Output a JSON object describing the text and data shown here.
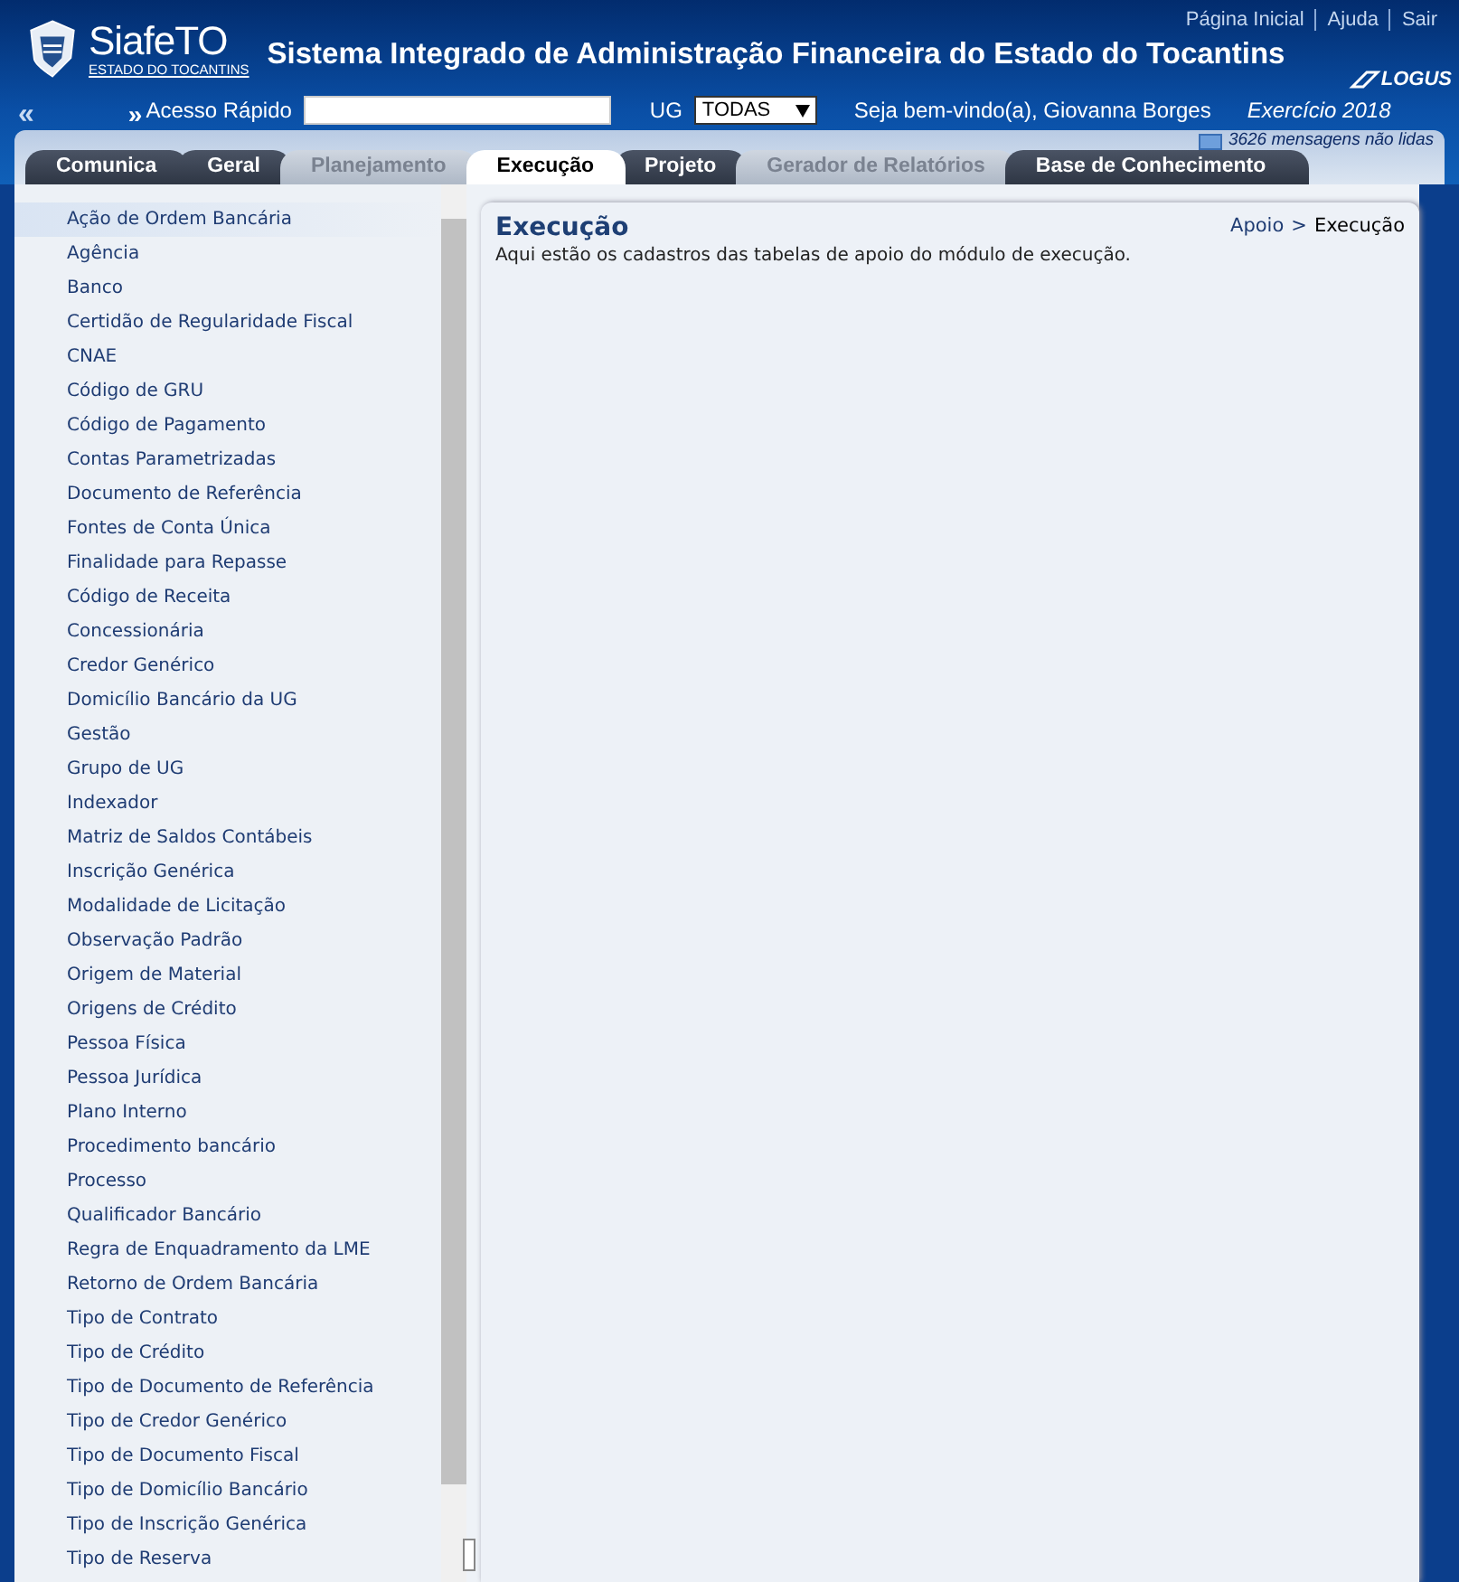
{
  "header": {
    "logo_name": "SiafeTO",
    "logo_subtitle": "ESTADO DO TOCANTINS",
    "title": "Sistema Integrado de Administração Financeira do Estado do Tocantins",
    "links": [
      "Página Inicial",
      "Ajuda",
      "Sair"
    ],
    "vendor": "LOGUS",
    "collapse": "«",
    "quick_marker": "»",
    "quick_access_label": "Acesso Rápido",
    "ug_label": "UG",
    "ug_value": "TODAS",
    "welcome": "Seja bem-vindo(a), Giovanna Borges",
    "year": "Exercício 2018",
    "messages": "3626 mensagens não lidas"
  },
  "tabs": [
    {
      "label": "Comunica",
      "selected": false,
      "disabled": false
    },
    {
      "label": "Geral",
      "selected": false,
      "disabled": false
    },
    {
      "label": "Planejamento",
      "selected": false,
      "disabled": true
    },
    {
      "label": "Execução",
      "selected": true,
      "disabled": false
    },
    {
      "label": "Projeto",
      "selected": false,
      "disabled": false
    },
    {
      "label": "Gerador de Relatórios",
      "selected": false,
      "disabled": true
    },
    {
      "label": "Base de Conhecimento",
      "selected": false,
      "disabled": false
    }
  ],
  "sidebar": {
    "items": [
      {
        "label": "Ação de Ordem Bancária",
        "selected": true
      },
      {
        "label": "Agência",
        "selected": false
      },
      {
        "label": "Banco",
        "selected": false
      },
      {
        "label": "Certidão de Regularidade Fiscal",
        "selected": false
      },
      {
        "label": "CNAE",
        "selected": false
      },
      {
        "label": "Código de GRU",
        "selected": false
      },
      {
        "label": "Código de Pagamento",
        "selected": false
      },
      {
        "label": "Contas Parametrizadas",
        "selected": false
      },
      {
        "label": "Documento de Referência",
        "selected": false
      },
      {
        "label": "Fontes de Conta Única",
        "selected": false
      },
      {
        "label": "Finalidade para Repasse",
        "selected": false
      },
      {
        "label": "Código de Receita",
        "selected": false
      },
      {
        "label": "Concessionária",
        "selected": false
      },
      {
        "label": "Credor Genérico",
        "selected": false
      },
      {
        "label": "Domicílio Bancário da UG",
        "selected": false
      },
      {
        "label": "Gestão",
        "selected": false
      },
      {
        "label": "Grupo de UG",
        "selected": false
      },
      {
        "label": "Indexador",
        "selected": false
      },
      {
        "label": "Matriz de Saldos Contábeis",
        "selected": false
      },
      {
        "label": "Inscrição Genérica",
        "selected": false
      },
      {
        "label": "Modalidade de Licitação",
        "selected": false
      },
      {
        "label": "Observação Padrão",
        "selected": false
      },
      {
        "label": "Origem de Material",
        "selected": false
      },
      {
        "label": "Origens de Crédito",
        "selected": false
      },
      {
        "label": "Pessoa Física",
        "selected": false
      },
      {
        "label": "Pessoa Jurídica",
        "selected": false
      },
      {
        "label": "Plano Interno",
        "selected": false
      },
      {
        "label": "Procedimento bancário",
        "selected": false
      },
      {
        "label": "Processo",
        "selected": false
      },
      {
        "label": "Qualificador Bancário",
        "selected": false
      },
      {
        "label": "Regra de Enquadramento da LME",
        "selected": false
      },
      {
        "label": "Retorno de Ordem Bancária",
        "selected": false
      },
      {
        "label": "Tipo de Contrato",
        "selected": false
      },
      {
        "label": "Tipo de Crédito",
        "selected": false
      },
      {
        "label": "Tipo de Documento de Referência",
        "selected": false
      },
      {
        "label": "Tipo de Credor Genérico",
        "selected": false
      },
      {
        "label": "Tipo de Documento Fiscal",
        "selected": false
      },
      {
        "label": "Tipo de Domicílio Bancário",
        "selected": false
      },
      {
        "label": "Tipo de Inscrição Genérica",
        "selected": false
      },
      {
        "label": "Tipo de Reserva",
        "selected": false
      }
    ]
  },
  "content": {
    "title": "Execução",
    "breadcrumb": [
      "Apoio",
      "Execução"
    ],
    "breadcrumb_separator": ">",
    "description": "Aqui estão os cadastros das tabelas de apoio do módulo de execução."
  }
}
